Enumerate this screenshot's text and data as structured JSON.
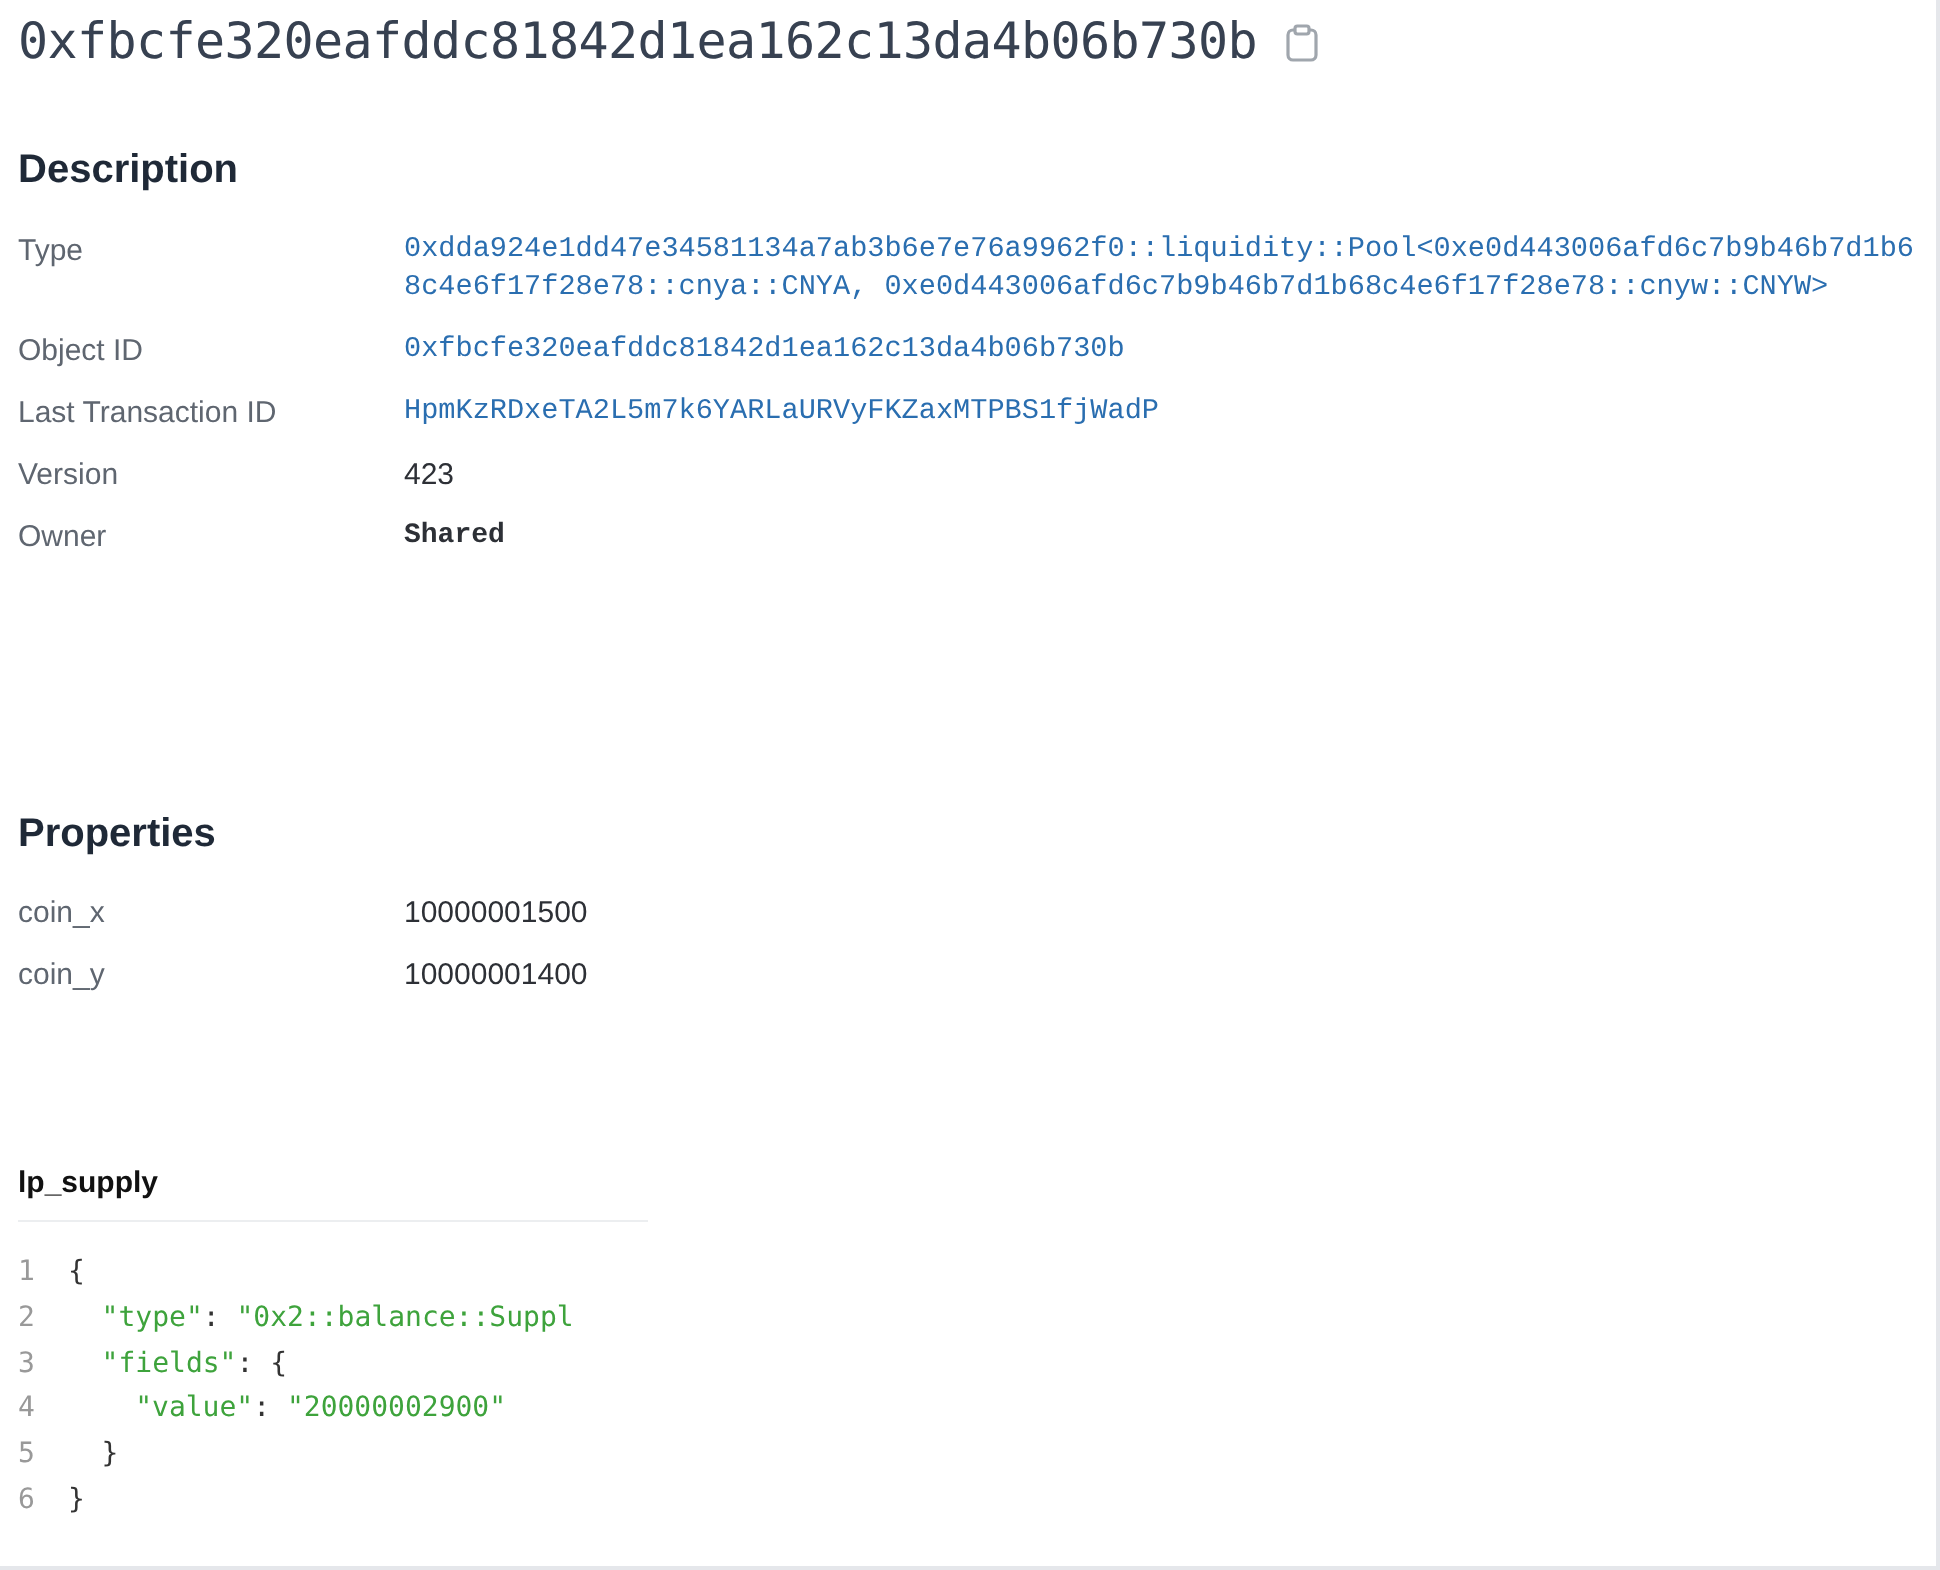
{
  "title": "0xfbcfe320eafddc81842d1ea162c13da4b06b730b",
  "description": {
    "heading": "Description",
    "rows": [
      {
        "label": "Type",
        "value": "0xdda924e1dd47e34581134a7ab3b6e7e76a9962f0::liquidity::Pool<0xe0d443006afd6c7b9b46b7d1b68c4e6f17f28e78::cnya::CNYA, 0xe0d443006afd6c7b9b46b7d1b68c4e6f17f28e78::cnyw::CNYW>",
        "kind": "link"
      },
      {
        "label": "Object ID",
        "value": "0xfbcfe320eafddc81842d1ea162c13da4b06b730b",
        "kind": "link"
      },
      {
        "label": "Last Transaction ID",
        "value": "HpmKzRDxeTA2L5m7k6YARLaURVyFKZaxMTPBS1fjWadP",
        "kind": "link"
      },
      {
        "label": "Version",
        "value": "423",
        "kind": "text"
      },
      {
        "label": "Owner",
        "value": "Shared",
        "kind": "strong"
      }
    ]
  },
  "properties": {
    "heading": "Properties",
    "rows": [
      {
        "label": "coin_x",
        "value": "10000001500"
      },
      {
        "label": "coin_y",
        "value": "10000001400"
      }
    ]
  },
  "lp_supply": {
    "heading": "lp_supply",
    "lines": [
      {
        "number": "1",
        "tokens": [
          {
            "kind": "punct",
            "text": "{"
          }
        ]
      },
      {
        "number": "2",
        "tokens": [
          {
            "kind": "string",
            "text": "\"type\""
          },
          {
            "kind": "punct",
            "text": ": "
          },
          {
            "kind": "string",
            "text": "\"0x2::balance::Suppl"
          }
        ]
      },
      {
        "number": "3",
        "tokens": [
          {
            "kind": "string",
            "text": "\"fields\""
          },
          {
            "kind": "punct",
            "text": ": {"
          }
        ]
      },
      {
        "number": "4",
        "tokens": [
          {
            "kind": "string",
            "text": "\"value\""
          },
          {
            "kind": "punct",
            "text": ": "
          },
          {
            "kind": "string",
            "text": "\"20000002900\""
          }
        ]
      },
      {
        "number": "5",
        "tokens": [
          {
            "kind": "punct",
            "text": "}"
          }
        ]
      },
      {
        "number": "6",
        "tokens": [
          {
            "kind": "punct",
            "text": "}"
          }
        ]
      }
    ]
  }
}
